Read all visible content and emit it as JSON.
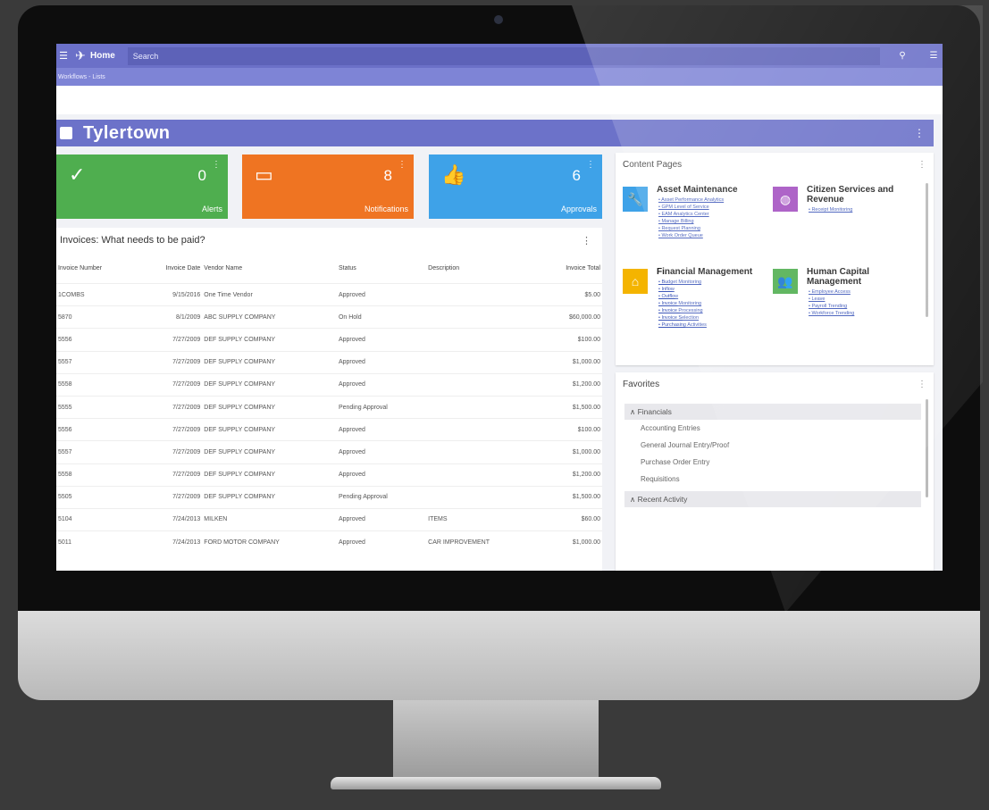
{
  "topbar": {
    "home_label": "Home",
    "search_placeholder": "Search"
  },
  "breadcrumb": "Workflows - Lists",
  "page_title": "Tylertown",
  "tiles": [
    {
      "count": "0",
      "label": "Alerts",
      "icon": "check-icon",
      "color": "#4fae4f"
    },
    {
      "count": "8",
      "label": "Notifications",
      "icon": "message-icon",
      "color": "#ef7422"
    },
    {
      "count": "6",
      "label": "Approvals",
      "icon": "thumbs-up-icon",
      "color": "#3ea2e8"
    }
  ],
  "invoices": {
    "title": "Invoices: What needs to be paid?",
    "columns": [
      "Invoice Number",
      "Invoice Date",
      "Vendor Name",
      "Status",
      "Description",
      "Invoice Total"
    ],
    "rows": [
      [
        "1COMBS",
        "9/15/2016",
        "One Time Vendor",
        "Approved",
        "",
        "$5.00"
      ],
      [
        "5870",
        "8/1/2009",
        "ABC SUPPLY COMPANY",
        "On Hold",
        "",
        "$60,000.00"
      ],
      [
        "5556",
        "7/27/2009",
        "DEF SUPPLY COMPANY",
        "Approved",
        "",
        "$100.00"
      ],
      [
        "5557",
        "7/27/2009",
        "DEF SUPPLY COMPANY",
        "Approved",
        "",
        "$1,000.00"
      ],
      [
        "5558",
        "7/27/2009",
        "DEF SUPPLY COMPANY",
        "Approved",
        "",
        "$1,200.00"
      ],
      [
        "5555",
        "7/27/2009",
        "DEF SUPPLY COMPANY",
        "Pending Approval",
        "",
        "$1,500.00"
      ],
      [
        "5556",
        "7/27/2009",
        "DEF SUPPLY COMPANY",
        "Approved",
        "",
        "$100.00"
      ],
      [
        "5557",
        "7/27/2009",
        "DEF SUPPLY COMPANY",
        "Approved",
        "",
        "$1,000.00"
      ],
      [
        "5558",
        "7/27/2009",
        "DEF SUPPLY COMPANY",
        "Approved",
        "",
        "$1,200.00"
      ],
      [
        "5505",
        "7/27/2009",
        "DEF SUPPLY COMPANY",
        "Pending Approval",
        "",
        "$1,500.00"
      ],
      [
        "5104",
        "7/24/2013",
        "MILKEN",
        "Approved",
        "ITEMS",
        "$60.00"
      ],
      [
        "5011",
        "7/24/2013",
        "FORD MOTOR COMPANY",
        "Approved",
        "CAR IMPROVEMENT",
        "$1,000.00"
      ]
    ]
  },
  "content_pages": {
    "title": "Content Pages",
    "items": [
      {
        "name": "Asset Maintenance",
        "icon": "wrench-icon",
        "color": "#3ea2e8",
        "links": [
          "• Asset Performance Analytics",
          "• GPM Level of Service",
          "• EAM Analytics Center",
          "• Manage Billing",
          "• Request Planning",
          "• Work Order Queue"
        ]
      },
      {
        "name": "Citizen Services and Revenue",
        "icon": "globe-icon",
        "color": "#a34fc0",
        "links": [
          "• Receipt Monitoring"
        ]
      },
      {
        "name": "Financial Management",
        "icon": "bank-icon",
        "color": "#f4b400",
        "links": [
          "• Budget Monitoring",
          "• Inflow",
          "• Outflow",
          "• Invoice Monitoring",
          "• Invoice Processing",
          "• Invoice Selection",
          "• Purchasing Activities"
        ]
      },
      {
        "name": "Human Capital Management",
        "icon": "people-icon",
        "color": "#4fae4f",
        "links": [
          "• Employee Access",
          "• Leave",
          "• Payroll Trending",
          "• Workforce Trending"
        ]
      }
    ]
  },
  "favorites": {
    "title": "Favorites",
    "group1": "∧ Financials",
    "links": [
      "Accounting Entries",
      "General Journal Entry/Proof",
      "Purchase Order Entry",
      "Requisitions"
    ],
    "group2": "∧ Recent Activity"
  }
}
